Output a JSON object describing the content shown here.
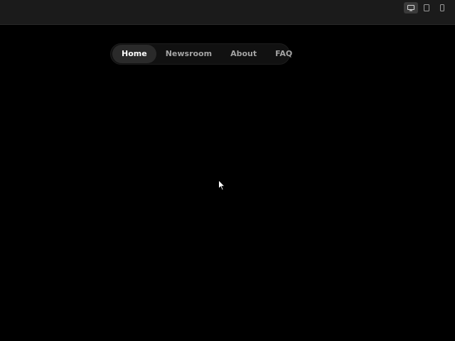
{
  "toolbar": {
    "device_icons": [
      "desktop-icon",
      "tablet-icon",
      "mobile-icon"
    ],
    "active_device": "desktop"
  },
  "nav": {
    "items": [
      {
        "label": "Home",
        "active": true
      },
      {
        "label": "Newsroom",
        "active": false
      },
      {
        "label": "About",
        "active": false
      },
      {
        "label": "FAQ",
        "active": false
      }
    ]
  },
  "colors": {
    "background": "#000000",
    "topbar": "#1b1b1b",
    "nav_bg": "#111111",
    "active_pill": "#2a2a2a",
    "active_text": "#ffffff",
    "inactive_text": "#a4a4a4"
  }
}
